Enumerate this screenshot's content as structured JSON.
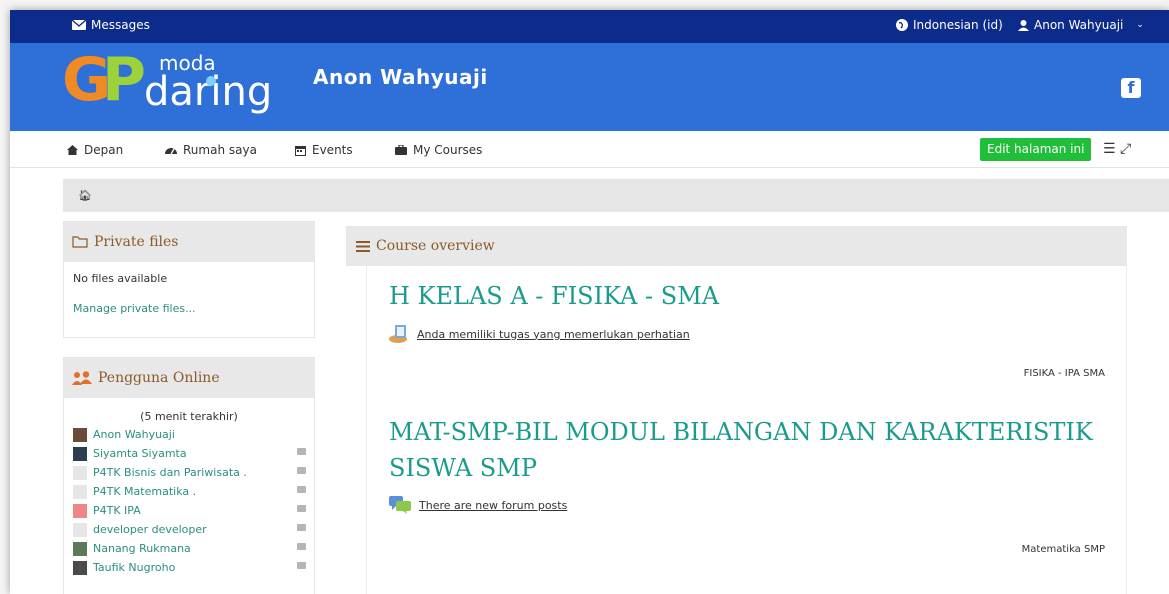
{
  "topbar": {
    "messages": "Messages",
    "language": "Indonesian (id)",
    "user": "Anon Wahyuaji"
  },
  "banner": {
    "logo_g": "G",
    "logo_p": "P",
    "logo_moda": "moda",
    "logo_daring": "daring",
    "user_name": "Anon Wahyuaji"
  },
  "nav": {
    "items": [
      {
        "label": "Depan",
        "icon": "home-icon"
      },
      {
        "label": "Rumah saya",
        "icon": "dashboard-icon"
      },
      {
        "label": "Events",
        "icon": "calendar-icon"
      },
      {
        "label": "My Courses",
        "icon": "briefcase-icon"
      }
    ],
    "edit_label": "Edit halaman ini"
  },
  "private_files": {
    "title": "Private files",
    "empty": "No files available",
    "manage": "Manage private files..."
  },
  "online_users": {
    "title": "Pengguna Online",
    "subtitle": "(5 menit terakhir)",
    "users": [
      {
        "name": "Anon Wahyuaji",
        "avatar_color": "#6b4a3a",
        "chat": false
      },
      {
        "name": "Siyamta Siyamta",
        "avatar_color": "#2c3e50",
        "chat": true
      },
      {
        "name": "P4TK Bisnis dan Pariwisata .",
        "avatar_color": "#e6e6e6",
        "chat": true
      },
      {
        "name": "P4TK Matematika .",
        "avatar_color": "#e6e6e6",
        "chat": true
      },
      {
        "name": "P4TK IPA",
        "avatar_color": "#e88",
        "chat": true
      },
      {
        "name": "developer developer",
        "avatar_color": "#e6e6e6",
        "chat": true
      },
      {
        "name": "Nanang Rukmana",
        "avatar_color": "#5a7a5a",
        "chat": true
      },
      {
        "name": "Taufik Nugroho",
        "avatar_color": "#4a4a4a",
        "chat": true
      }
    ]
  },
  "course_overview": {
    "title": "Course overview",
    "courses": [
      {
        "title": "H KELAS A - FISIKA - SMA",
        "notice": "Anda memiliki tugas yang memerlukan perhatian",
        "notice_icon": "assignment-icon",
        "category": "FISIKA - IPA SMA"
      },
      {
        "title_line1": "MAT-SMP-BIL MODUL BILANGAN DAN KARAKTERISTIK",
        "title_line2": "SISWA SMP",
        "notice": "There are new forum posts",
        "notice_icon": "forum-icon",
        "category": "Matematika SMP"
      }
    ]
  },
  "colors": {
    "topbar": "#0d2b8a",
    "banner": "#2f6fd8",
    "accent_green": "#1fbf3a",
    "course_title": "#1a9c8c",
    "block_title": "#8a5a2a"
  }
}
